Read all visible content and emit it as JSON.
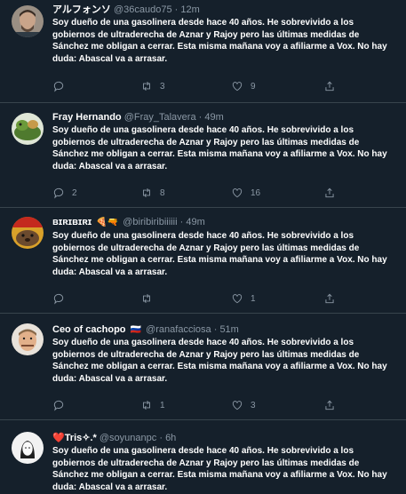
{
  "tweets": [
    {
      "name": "アルフォンソ",
      "badge": "",
      "handle": "@36caudo75",
      "time": "12m",
      "text": "Soy dueño de una gasolinera desde hace 40 años. He sobrevivido a los gobiernos de ultraderecha de Aznar y Rajoy pero las últimas medidas de Sánchez me obligan a cerrar. Esta misma mañana voy a afiliarme a Vox. No hay duda: Abascal va a arrasar.",
      "replies": "",
      "retweets": "3",
      "likes": "9"
    },
    {
      "name": "Fray Hernando",
      "badge": "",
      "handle": "@Fray_Talavera",
      "time": "49m",
      "text": "Soy dueño de una gasolinera desde hace 40 años. He sobrevivido a los gobiernos de ultraderecha de Aznar y Rajoy pero las últimas medidas de Sánchez me obligan a cerrar. Esta misma mañana voy a afiliarme a Vox. No hay duda: Abascal va a arrasar.",
      "replies": "2",
      "retweets": "8",
      "likes": "16"
    },
    {
      "name": "ʙɪʀɪʙɪʀɪ",
      "badge": "🍕🔫",
      "handle": "@biribiribiiiiii",
      "time": "49m",
      "text": "Soy dueño de una gasolinera desde hace 40 años. He sobrevivido a los gobiernos de ultraderecha de Aznar y Rajoy pero las últimas medidas de Sánchez me obligan a cerrar. Esta misma mañana voy a afiliarme a Vox. No hay duda: Abascal va a arrasar.",
      "replies": "",
      "retweets": "",
      "likes": "1"
    },
    {
      "name": "Ceo of cachopo",
      "badge": "🇷🇺",
      "handle": "@ranafacciosa",
      "time": "51m",
      "text": "Soy dueño de una gasolinera desde hace 40 años. He sobrevivido a los gobiernos de ultraderecha de Aznar y Rajoy pero las últimas medidas de Sánchez me obligan a cerrar. Esta misma mañana voy a afiliarme a Vox. No hay duda: Abascal va a arrasar.",
      "replies": "",
      "retweets": "1",
      "likes": "3"
    },
    {
      "name": "❤️Tris✧.*",
      "badge": "",
      "handle": "@soyunanpc",
      "time": "6h",
      "text": "Soy dueño de una gasolinera desde hace 40 años. He sobrevivido a los gobiernos de ultraderecha de Aznar y Rajoy pero las últimas medidas de Sánchez me obligan a cerrar. Esta misma mañana voy a afiliarme a Vox. No hay duda: Abascal va a arrasar.",
      "replies": "",
      "retweets": "",
      "likes": ""
    }
  ],
  "separator": "·",
  "icons": {
    "reply": "reply-icon",
    "retweet": "retweet-icon",
    "like": "like-icon",
    "share": "share-icon"
  },
  "colors": {
    "background": "#15202b",
    "muted": "#8b98a5",
    "border": "#38444d",
    "text": "#ffffff"
  }
}
